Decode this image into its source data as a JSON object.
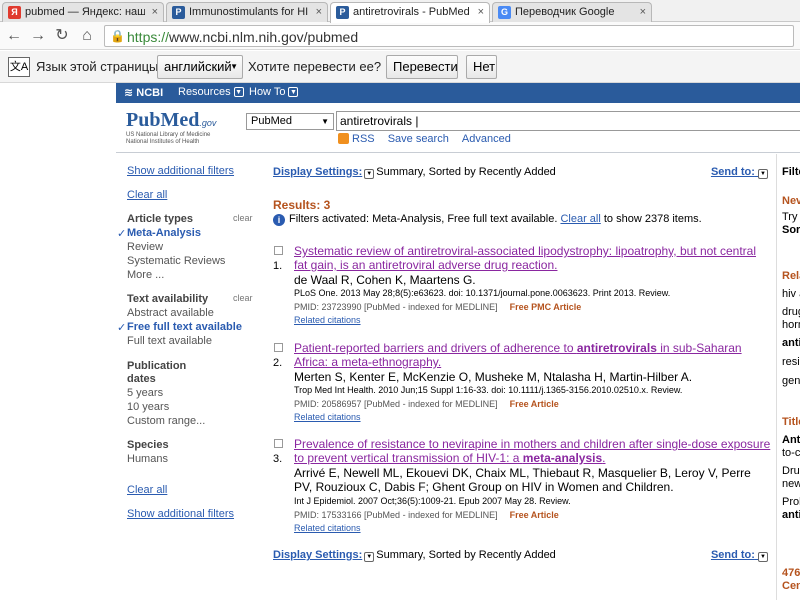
{
  "browser": {
    "tabs": [
      {
        "label": "pubmed — Яндекс: нашё",
        "favicon": "Я"
      },
      {
        "label": "Immunostimulants for HI",
        "favicon": "P"
      },
      {
        "label": "antiretrovirals - PubMed -",
        "favicon": "P"
      },
      {
        "label": "Переводчик Google",
        "favicon": "G"
      }
    ],
    "url_scheme": "https://",
    "url_rest": "www.ncbi.nlm.nih.gov/pubmed"
  },
  "translate": {
    "page_language_label": "Язык этой страницы",
    "language_value": "английский",
    "prompt": "Хотите перевести ее?",
    "translate_button": "Перевести",
    "no_button": "Нет"
  },
  "ncbi": {
    "logo": "NCBI",
    "resources": "Resources",
    "howto": "How To"
  },
  "pubmed": {
    "logo": "PubMed",
    "logo_gov": ".gov",
    "logo_sub1": "US National Library of Medicine",
    "logo_sub2": "National Institutes of Health",
    "db_value": "PubMed",
    "query": "antiretrovirals",
    "rss": "RSS",
    "save_search": "Save search",
    "advanced": "Advanced"
  },
  "filters": {
    "show_additional_top": "Show additional filters",
    "clear_all_top": "Clear all",
    "article_types_head": "Article types",
    "clear": "clear",
    "meta_analysis": "Meta-Analysis",
    "review": "Review",
    "systematic_reviews": "Systematic Reviews",
    "more": "More ...",
    "text_availability_head": "Text availability",
    "abstract_available": "Abstract available",
    "free_full_text": "Free full text available",
    "full_text": "Full text available",
    "publication_dates_head1": "Publication",
    "publication_dates_head2": "dates",
    "five_years": "5 years",
    "ten_years": "10 years",
    "custom_range": "Custom range...",
    "species_head": "Species",
    "humans": "Humans",
    "clear_all_bottom": "Clear all",
    "show_additional_bottom": "Show additional filters"
  },
  "results": {
    "display_settings_label": "Display Settings:",
    "display_settings_value": "Summary, Sorted by Recently Added",
    "send_to": "Send to:",
    "count_label": "Results: 3",
    "filters_note_a": "Filters activated: Meta-Analysis, Free full text available.",
    "filters_note_link": "Clear all",
    "filters_note_b": "to show 2378 items.",
    "items": [
      {
        "num": "1.",
        "title": "Systematic review of antiretroviral-associated lipodystrophy: lipoatrophy, but not central fat gain, is an antiretroviral adverse drug reaction.",
        "authors": "de Waal R, Cohen K, Maartens G.",
        "journal": "PLoS One. 2013 May 28;8(5):e63623. doi: 10.1371/journal.pone.0063623. Print 2013. Review.",
        "pmid": "PMID: 23723990 [PubMed - indexed for MEDLINE]",
        "free": "Free PMC Article",
        "related": "Related citations"
      },
      {
        "num": "2.",
        "title": "Patient-reported barriers and drivers of adherence to antiretrovirals in sub-Saharan Africa: a meta-ethnography.",
        "authors": "Merten S, Kenter E, McKenzie O, Musheke M, Ntalasha H, Martin-Hilber A.",
        "journal": "Trop Med Int Health. 2010 Jun;15 Suppl 1:16-33. doi: 10.1111/j.1365-3156.2010.02510.x. Review.",
        "pmid": "PMID: 20586957 [PubMed - indexed for MEDLINE]",
        "free": "Free Article",
        "related": "Related citations"
      },
      {
        "num": "3.",
        "title": "Prevalence of resistance to nevirapine in mothers and children after single-dose exposure to prevent vertical transmission of HIV-1: a meta-analysis.",
        "authors": "Arrivé E, Newell ML, Ekouevi DK, Chaix ML, Thiebaut R, Masquelier B, Leroy V, Perre PV, Rouzioux C, Dabis F; Ghent Group on HIV in Women and Children.",
        "journal": "Int J Epidemiol. 2007 Oct;36(5):1009-21. Epub 2007 May 28. Review.",
        "pmid": "PMID: 17533166 [PubMed - indexed for MEDLINE]",
        "free": "Free Article",
        "related": "Related citations"
      }
    ]
  },
  "rightcol": {
    "lines": [
      "Filte",
      "Nev",
      "Try t",
      "Sort",
      "Rela",
      "hiv a",
      "drug",
      "horm",
      "antir",
      "resis",
      "gene",
      "Title",
      "Anti",
      "to-ch",
      "Drug",
      "new",
      "Prob",
      "antir",
      "476",
      "Cen"
    ]
  }
}
